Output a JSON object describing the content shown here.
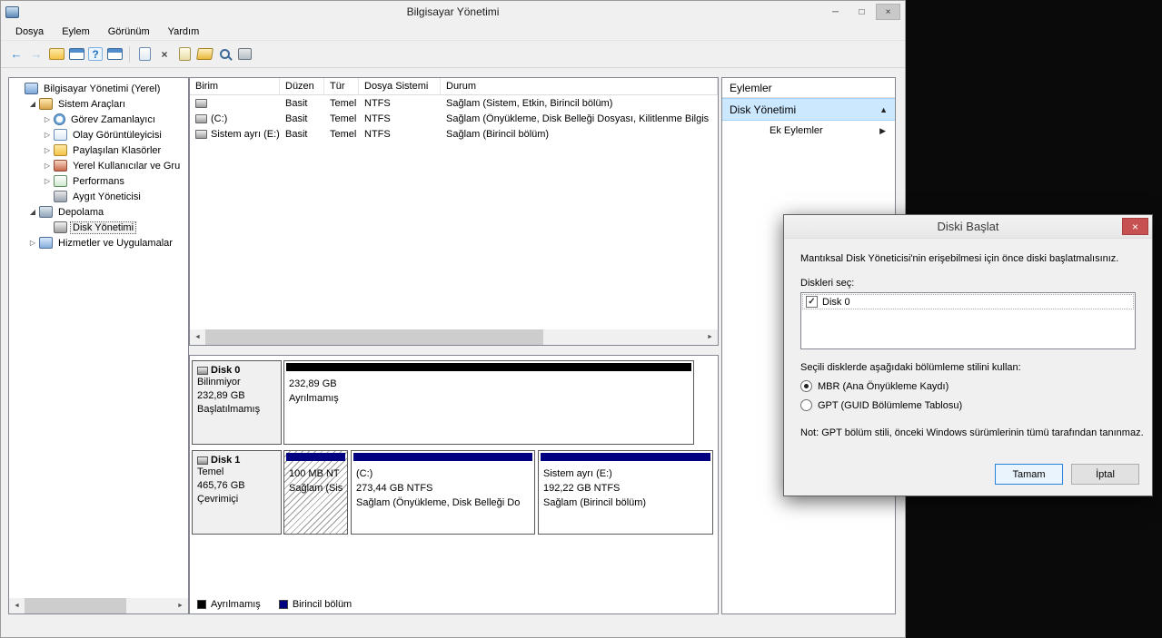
{
  "window": {
    "title": "Bilgisayar Yönetimi"
  },
  "menu": {
    "items": [
      "Dosya",
      "Eylem",
      "Görünüm",
      "Yardım"
    ]
  },
  "glyphs": {
    "back": "←",
    "forward": "→",
    "help": "?",
    "delete": "×",
    "minimize": "─",
    "maximize": "□",
    "close": "×",
    "tree_expanded": "◢",
    "tree_collapsed": "▷",
    "scroll_left": "◄",
    "scroll_right": "►",
    "chevron_up": "▲",
    "chevron_right": "▶",
    "check": "✓"
  },
  "tree": {
    "root": "Bilgisayar Yönetimi (Yerel)",
    "items": [
      "Sistem Araçları",
      "Görev Zamanlayıcı",
      "Olay Görüntüleyicisi",
      "Paylaşılan Klasörler",
      "Yerel Kullanıcılar ve Gru",
      "Performans",
      "Aygıt Yöneticisi",
      "Depolama",
      "Disk Yönetimi",
      "Hizmetler ve Uygulamalar"
    ]
  },
  "volumes": {
    "columns": [
      "Birim",
      "Düzen",
      "Tür",
      "Dosya Sistemi",
      "Durum"
    ],
    "rows": [
      {
        "name": "",
        "layout": "Basit",
        "type": "Temel",
        "fs": "NTFS",
        "status": "Sağlam (Sistem, Etkin, Birincil bölüm)"
      },
      {
        "name": "(C:)",
        "layout": "Basit",
        "type": "Temel",
        "fs": "NTFS",
        "status": "Sağlam (Önyükleme, Disk Belleği Dosyası, Kilitlenme Bilgis"
      },
      {
        "name": "Sistem ayrı (E:)",
        "layout": "Basit",
        "type": "Temel",
        "fs": "NTFS",
        "status": "Sağlam (Birincil bölüm)"
      }
    ]
  },
  "disks": [
    {
      "name": "Disk 0",
      "type": "Bilinmiyor",
      "size": "232,89 GB",
      "status": "Başlatılmamış",
      "region": {
        "size": "232,89 GB",
        "info": "Ayrılmamış"
      }
    },
    {
      "name": "Disk 1",
      "type": "Temel",
      "size": "465,76 GB",
      "status": "Çevrimiçi",
      "partitions": [
        {
          "label": "",
          "size": "100 MB NT",
          "info": "Sağlam (Sis"
        },
        {
          "label": "(C:)",
          "size": "273,44 GB NTFS",
          "info": "Sağlam (Önyükleme, Disk Belleği Do"
        },
        {
          "label": "Sistem ayrı  (E:)",
          "size": "192,22 GB NTFS",
          "info": "Sağlam (Birincil bölüm)"
        }
      ]
    }
  ],
  "legend": {
    "items": [
      {
        "label": "Ayrılmamış",
        "color": "#000000"
      },
      {
        "label": "Birincil bölüm",
        "color": "#000080"
      }
    ]
  },
  "actions": {
    "header": "Eylemler",
    "main": "Disk Yönetimi",
    "sub": "Ek Eylemler"
  },
  "dialog": {
    "title": "Diski Başlat",
    "intro": "Mantıksal Disk Yöneticisi'nin erişebilmesi için önce diski başlatmalısınız.",
    "select_label": "Diskleri seç:",
    "disk_item": "Disk 0",
    "group_label": "Seçili disklerde aşağıdaki bölümleme stilini kullan:",
    "mbr_label": "MBR (Ana Önyükleme Kaydı)",
    "gpt_label": "GPT (GUID Bölümleme Tablosu)",
    "note": "Not: GPT bölüm stili, önceki Windows sürümlerinin tümü tarafından tanınmaz.",
    "ok": "Tamam",
    "cancel": "İptal"
  }
}
